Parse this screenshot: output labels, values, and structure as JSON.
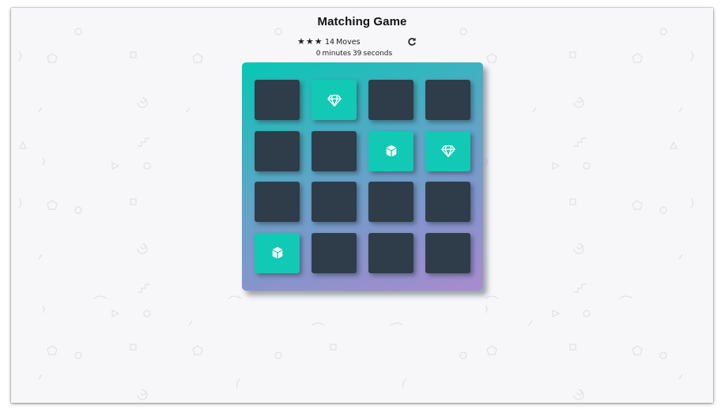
{
  "title": "Matching Game",
  "score": {
    "stars": [
      "★",
      "★",
      "★"
    ],
    "moves_count": "14",
    "moves_label": "Moves",
    "restart_icon": "repeat-icon"
  },
  "timer": {
    "minutes": "0",
    "minutes_label": "minutes",
    "seconds": "39",
    "seconds_label": "seconds"
  },
  "colors": {
    "card_hidden": "#2e3d49",
    "card_open": "#12c9b5",
    "deck_gradient_start": "#05c8b4",
    "deck_gradient_end": "#a98bcf"
  },
  "cards": [
    {
      "state": "hidden",
      "icon": ""
    },
    {
      "state": "open",
      "icon": "diamond-icon"
    },
    {
      "state": "hidden",
      "icon": ""
    },
    {
      "state": "hidden",
      "icon": ""
    },
    {
      "state": "hidden",
      "icon": ""
    },
    {
      "state": "hidden",
      "icon": ""
    },
    {
      "state": "open",
      "icon": "cube-icon"
    },
    {
      "state": "open",
      "icon": "diamond-icon"
    },
    {
      "state": "hidden",
      "icon": ""
    },
    {
      "state": "hidden",
      "icon": ""
    },
    {
      "state": "hidden",
      "icon": ""
    },
    {
      "state": "hidden",
      "icon": ""
    },
    {
      "state": "open",
      "icon": "cube-icon"
    },
    {
      "state": "hidden",
      "icon": ""
    },
    {
      "state": "hidden",
      "icon": ""
    },
    {
      "state": "hidden",
      "icon": ""
    }
  ]
}
